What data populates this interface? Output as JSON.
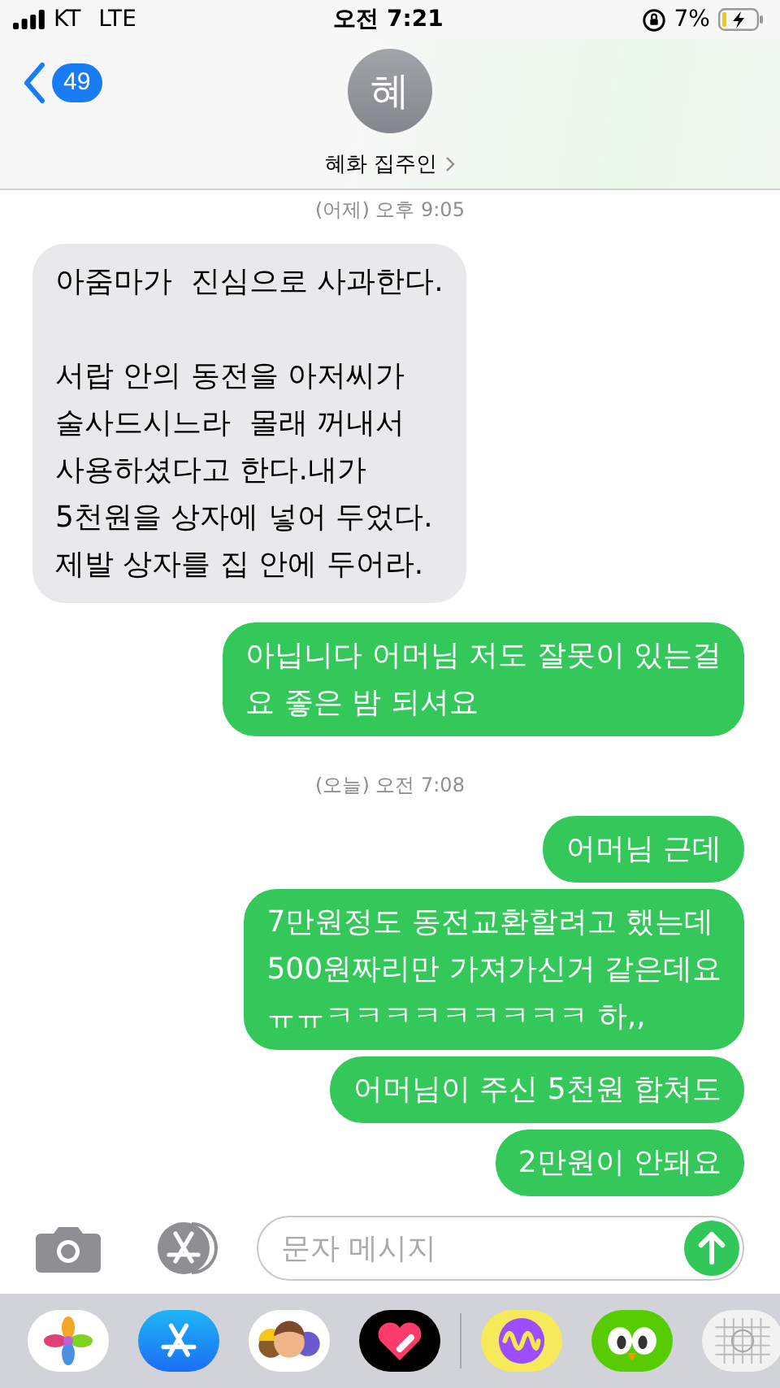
{
  "status_bar": {
    "carrier": "KT",
    "network": "LTE",
    "time": "오전 7:21",
    "battery": "7%",
    "charging": true
  },
  "header": {
    "unread_count": "49",
    "avatar_initial": "혜",
    "contact_name": "혜화 집주인"
  },
  "messages": [
    {
      "kind": "timestamp",
      "text": "(어제) 오후 9:05"
    },
    {
      "kind": "incoming",
      "text": "아줌마가  진심으로 사과한다.\n\n서랍 안의 동전을 아저씨가\n술사드시느라  몰래 꺼내서\n사용하셨다고 한다.내가\n5천원을 상자에 넣어 두었다.\n제발 상자를 집 안에 두어라."
    },
    {
      "kind": "outgoing",
      "text": "아닙니다 어머님 저도 잘못이 있는걸\n요 좋은 밤 되셔요"
    },
    {
      "kind": "timestamp",
      "text": "(오늘) 오전 7:08"
    },
    {
      "kind": "outgoing",
      "text": "어머님 근데"
    },
    {
      "kind": "outgoing",
      "text": "7만원정도 동전교환할려고 했는데\n500원짜리만 가져가신거 같은데요\nㅠㅠㅋㅋㅋㅋㅋㅋㅋㅋㅋ 하,,"
    },
    {
      "kind": "outgoing",
      "text": "어머님이 주신 5천원 합쳐도"
    },
    {
      "kind": "outgoing",
      "text": "2만원이 안돼요"
    }
  ],
  "composer": {
    "placeholder": "문자 메시지"
  }
}
